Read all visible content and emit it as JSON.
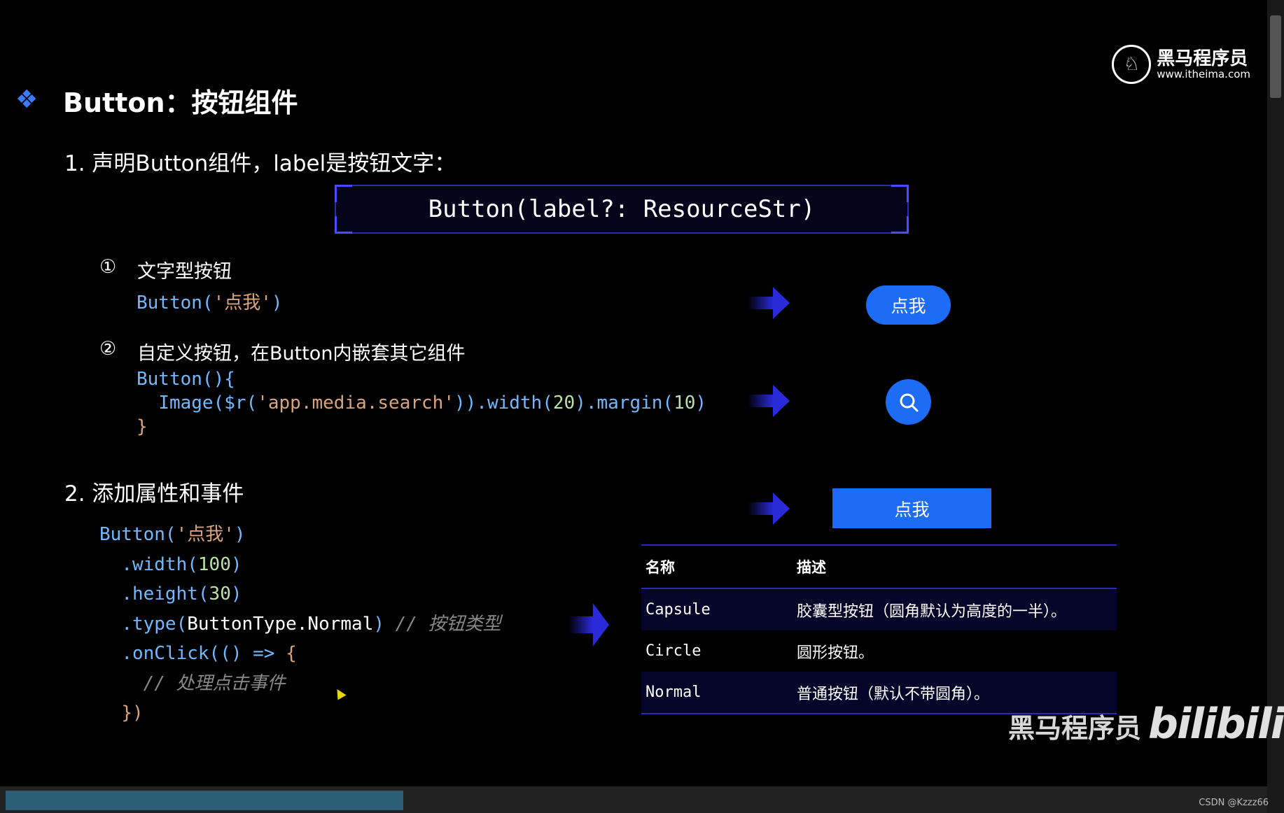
{
  "brand": {
    "logo_cn": "黑马程序员",
    "logo_url": "www.itheima.com"
  },
  "title": "Button：按钮组件",
  "section1": {
    "heading": "1. 声明Button组件，label是按钮文字：",
    "signature": "Button(label?: ResourceStr)",
    "item1": {
      "marker": "①",
      "label": "文字型按钮"
    },
    "item2": {
      "marker": "②",
      "label": "自定义按钮，在Button内嵌套其它组件"
    }
  },
  "section2": {
    "heading": "2. 添加属性和事件"
  },
  "demo": {
    "capsule_label": "点我",
    "normal_label": "点我"
  },
  "table": {
    "headers": [
      "名称",
      "描述"
    ],
    "rows": [
      {
        "name": "Capsule",
        "desc": "胶囊型按钮（圆角默认为高度的一半）。"
      },
      {
        "name": "Circle",
        "desc": "圆形按钮。"
      },
      {
        "name": "Normal",
        "desc": "普通按钮（默认不带圆角）。"
      }
    ]
  },
  "watermark": {
    "text": "黑马程序员",
    "bili": "bilibili"
  },
  "csdn": "CSDN @Kzzz66",
  "colors": {
    "accent_blue": "#1d6cf5",
    "frame": "#2a2ab8"
  }
}
